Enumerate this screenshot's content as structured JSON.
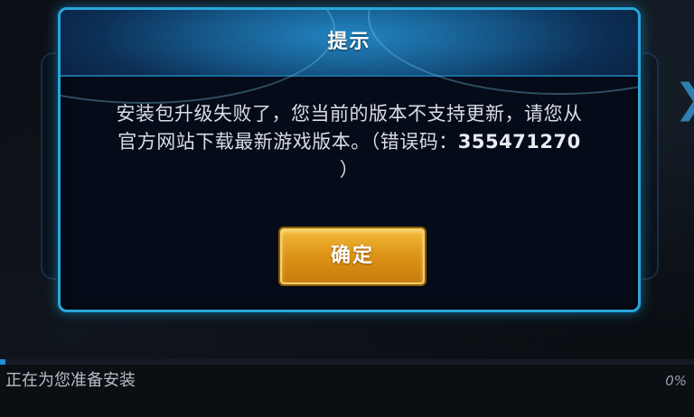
{
  "dialog": {
    "title": "提示",
    "message_line1": "安装包升级失败了，您当前的版本不支持更新，请您从",
    "message_line2": "官方网站下载最新游戏版本。（错误码：",
    "error_code": "355471270",
    "message_line3": "）",
    "confirm_label": "确定"
  },
  "install": {
    "status": "正在为您准备安装",
    "progress_percent": 0,
    "progress_label": "0%"
  }
}
